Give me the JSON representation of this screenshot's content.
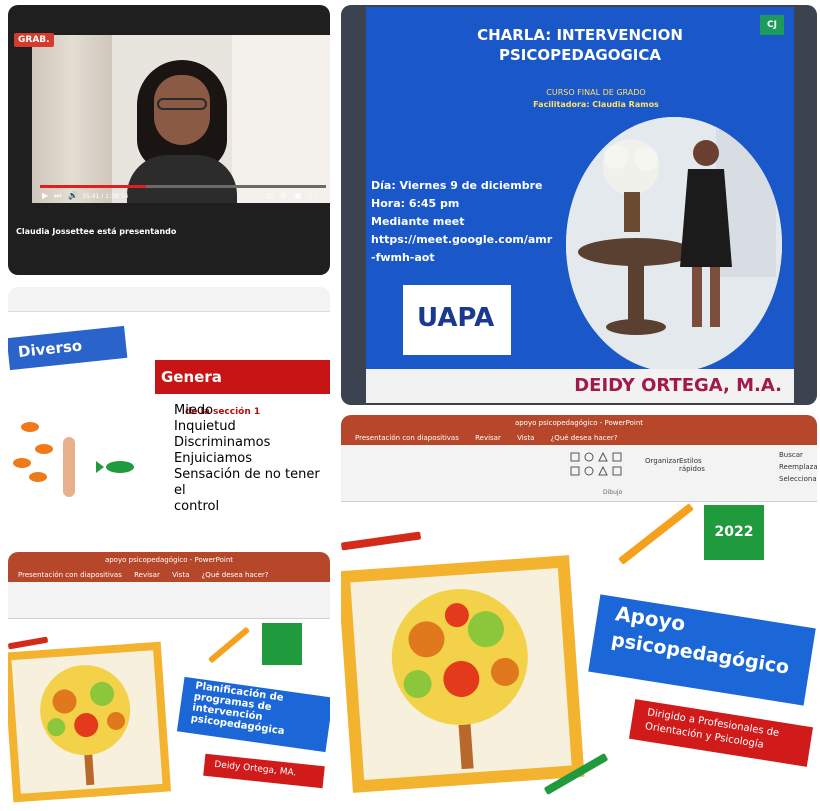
{
  "video_call": {
    "rec_badge": "GRAB.",
    "time": "35:41 / 1:38:54",
    "presenter_caption": "Claudia Jossettee está presentando",
    "progress_fraction": 0.37
  },
  "flyer": {
    "title_line1": "CHARLA: INTERVENCION",
    "title_line2": "PSICOPEDAGOGICA",
    "course": "CURSO FINAL DE GRADO",
    "facilitator": "Facilitadora: Claudia Ramos",
    "day": "Día: Viernes 9 de diciembre",
    "time": "Hora: 6:45 pm",
    "via": "Mediante meet",
    "link_line1": "https://meet.google.com/amr",
    "link_line2": "-fwmh-aot",
    "logo_text": "UAPA",
    "author": "DEIDY ORTEGA, M.A.",
    "badge": "CJ"
  },
  "slide_genera": {
    "left_banner": "Diverso",
    "right_banner": "Genera",
    "ghost_text": "de la sección 1",
    "items": [
      "Miedo",
      "Inquietud",
      "Discriminamos",
      "Enjuiciamos",
      "Sensación de no tener el",
      "control"
    ]
  },
  "ppt_small": {
    "window_title": "apoyo psicopedagógico - PowerPoint",
    "tabs": [
      "Presentación con diapositivas",
      "Revisar",
      "Vista",
      "¿Qué desea hacer?"
    ],
    "slide_title_lines": [
      "Planificación de",
      "programas de",
      "intervención",
      "psicopedagógica"
    ],
    "author": "Deidy Ortega, MA."
  },
  "ppt_big": {
    "window_title": "apoyo psicopedagógico - PowerPoint",
    "tabs": [
      "Presentación con diapositivas",
      "Revisar",
      "Vista",
      "¿Qué desea hacer?"
    ],
    "ribbon_group_label": "Dibujo",
    "ribbon_items": [
      "Organizar",
      "Estilos rápidos",
      "Buscar",
      "Reemplazar",
      "Seleccionar"
    ],
    "year": "2022",
    "title_line1": "Apoyo",
    "title_line2": "psicopedagógico",
    "subtitle_line1": "Dirigido a Profesionales de",
    "subtitle_line2": "Orientación y Psicología"
  },
  "colors": {
    "flyer_blue": "#1a57c9",
    "ppt_orange": "#b7472a",
    "banner_red": "#c81414",
    "banner_blue": "#1c67d8",
    "green_accent": "#1f9a3c",
    "frame_yellow": "#f3b32e"
  }
}
